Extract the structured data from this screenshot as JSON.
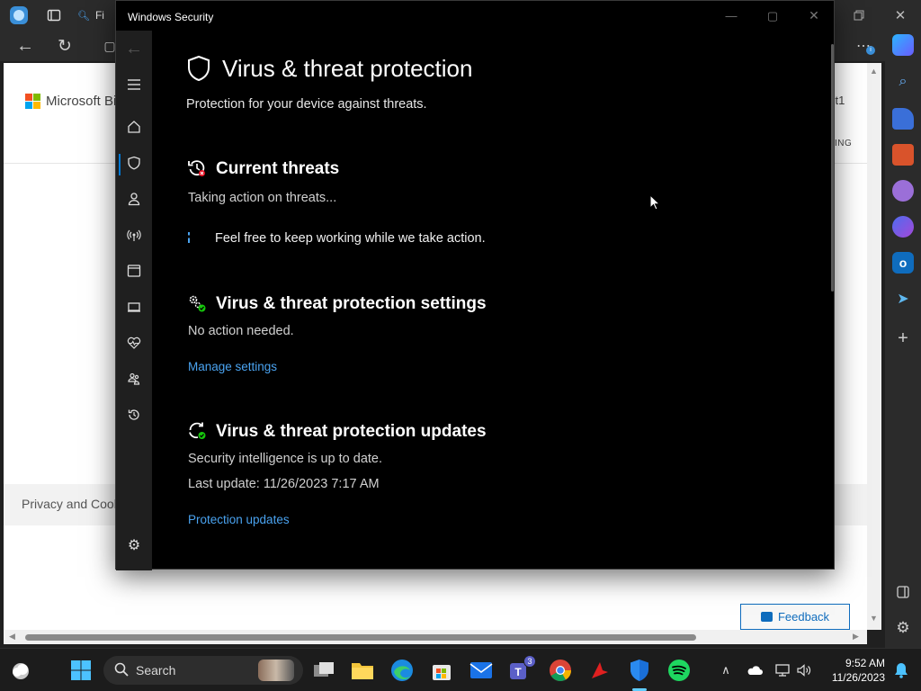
{
  "edge": {
    "tab_label": "Fi",
    "page_logo_text": "Microsoft Bi",
    "page_right_text": "st1",
    "page_right_text2": "ING",
    "privacy_text": "Privacy and Cook",
    "feedback_label": "Feedback"
  },
  "security_window": {
    "title": "Windows Security",
    "page_title": "Virus & threat protection",
    "page_subtitle": "Protection for your device against threats.",
    "current_threats": {
      "title": "Current threats",
      "status": "Taking action on threats...",
      "message": "Feel free to keep working while we take action."
    },
    "settings": {
      "title": "Virus & threat protection settings",
      "status": "No action needed.",
      "link": "Manage settings"
    },
    "updates": {
      "title": "Virus & threat protection updates",
      "status": "Security intelligence is up to date.",
      "last_update": "Last update: 11/26/2023 7:17 AM",
      "link": "Protection updates"
    }
  },
  "taskbar": {
    "search_label": "Search",
    "teams_badge": "3",
    "time": "9:52 AM",
    "date": "11/26/2023"
  },
  "colors": {
    "accent": "#0078d4",
    "link": "#4aa3f0",
    "window_bg": "#000000",
    "nav_bg": "#1f1f1f",
    "taskbar_bg": "#1c1c1c"
  }
}
